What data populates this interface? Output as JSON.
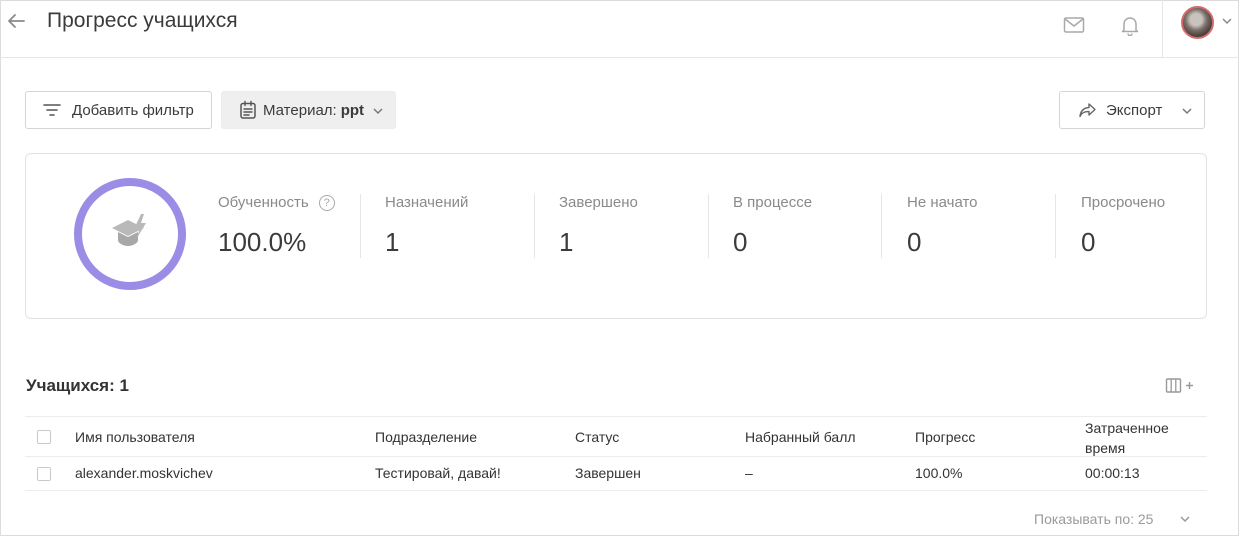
{
  "header": {
    "title": "Прогресс учащихся",
    "icons": [
      "arrow-left-icon",
      "mail-icon",
      "bell-icon",
      "avatar",
      "chevron-down-icon"
    ]
  },
  "toolbar": {
    "add_filter_label": "Добавить фильтр",
    "material_label": "Материал:",
    "material_value": "ppt",
    "export_label": "Экспорт"
  },
  "stats": {
    "ring_color": "#9b8ce6",
    "items": [
      {
        "label": "Обученность",
        "value": "100.0%"
      },
      {
        "label": "Назначений",
        "value": "1"
      },
      {
        "label": "Завершено",
        "value": "1"
      },
      {
        "label": "В процессе",
        "value": "0"
      },
      {
        "label": "Не начато",
        "value": "0"
      },
      {
        "label": "Просрочено",
        "value": "0"
      }
    ],
    "help_glyph": "?"
  },
  "table": {
    "count_label": "Учащихся: 1",
    "columns": [
      "Имя пользователя",
      "Подразделение",
      "Статус",
      "Набранный балл",
      "Прогресс",
      "Затраченное время"
    ],
    "rows": [
      {
        "name": "alexander.moskvichev",
        "department": "Тестировай, давай!",
        "status": "Завершен",
        "score": "–",
        "progress": "100.0%",
        "time": "00:00:13"
      }
    ],
    "columns_toggle_plus": "+"
  },
  "pager": {
    "label": "Показывать по: 25"
  }
}
